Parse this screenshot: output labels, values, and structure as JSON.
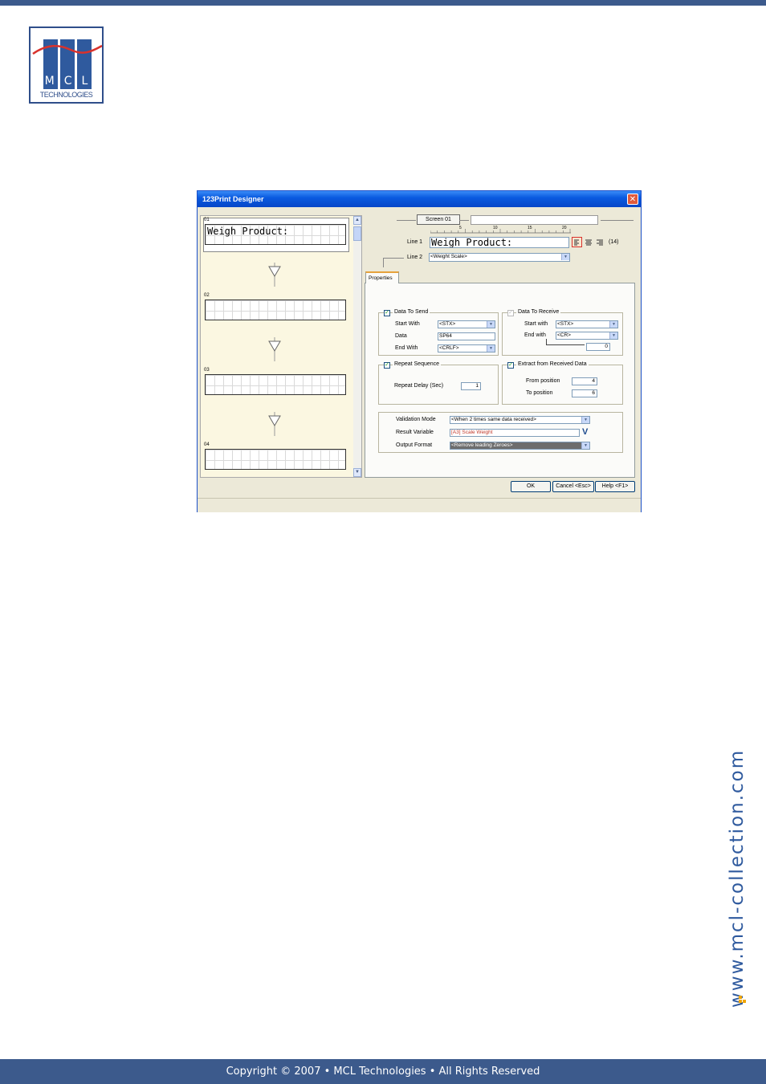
{
  "logo": {
    "letters": [
      "M",
      "C",
      "L"
    ],
    "subtitle": "TECHNOLOGIES"
  },
  "side_url": "www.mcl-collection.com",
  "footer": {
    "text": "Copyright © 2007 • MCL Technologies • All Rights Reserved"
  },
  "dialog": {
    "title": "123Print Designer",
    "close_glyph": "✕",
    "screens": [
      {
        "num": "01",
        "text": "Weigh Product:"
      },
      {
        "num": "02",
        "text": ""
      },
      {
        "num": "03",
        "text": ""
      },
      {
        "num": "04",
        "text": ""
      }
    ],
    "scroll": {
      "up": "▲",
      "down": "▼"
    },
    "screen_header": {
      "button": "Screen 01",
      "name_value": ""
    },
    "ruler": [
      "5",
      "10",
      "15",
      "20"
    ],
    "line1": {
      "label": "Line 1",
      "value": "Weigh Product:",
      "count": "(14)"
    },
    "line2": {
      "label": "Line 2",
      "value": "<Weight Scale>"
    },
    "tab": "Properties",
    "send": {
      "title": "Data To Send",
      "start_label": "Start With",
      "start_value": "<STX>",
      "data_label": "Data",
      "data_value": "SP64",
      "end_label": "End With",
      "end_value": "<CRLF>"
    },
    "receive": {
      "title": "Data To Receive",
      "start_label": "Start with",
      "start_value": "<STX>",
      "end_label": "End with",
      "end_value": "<CR>",
      "count_value": "0"
    },
    "repeat": {
      "title": "Repeat Sequence",
      "delay_label": "Repeat Delay (Sec)",
      "delay_value": "1"
    },
    "extract": {
      "title": "Extract from Received Data",
      "from_label": "From position",
      "from_value": "4",
      "to_label": "To position",
      "to_value": "6"
    },
    "validation": {
      "mode_label": "Validation Mode",
      "mode_value": "<When 2 times same data received>",
      "result_label": "Result Variable",
      "result_value": "[A3] Scale Weight",
      "result_icon": "V",
      "format_label": "Output Format",
      "format_value": "<Remove leading Zeroes>"
    },
    "buttons": {
      "ok": "OK",
      "cancel": "Cancel <Esc>",
      "help": "Help <F1>"
    }
  }
}
